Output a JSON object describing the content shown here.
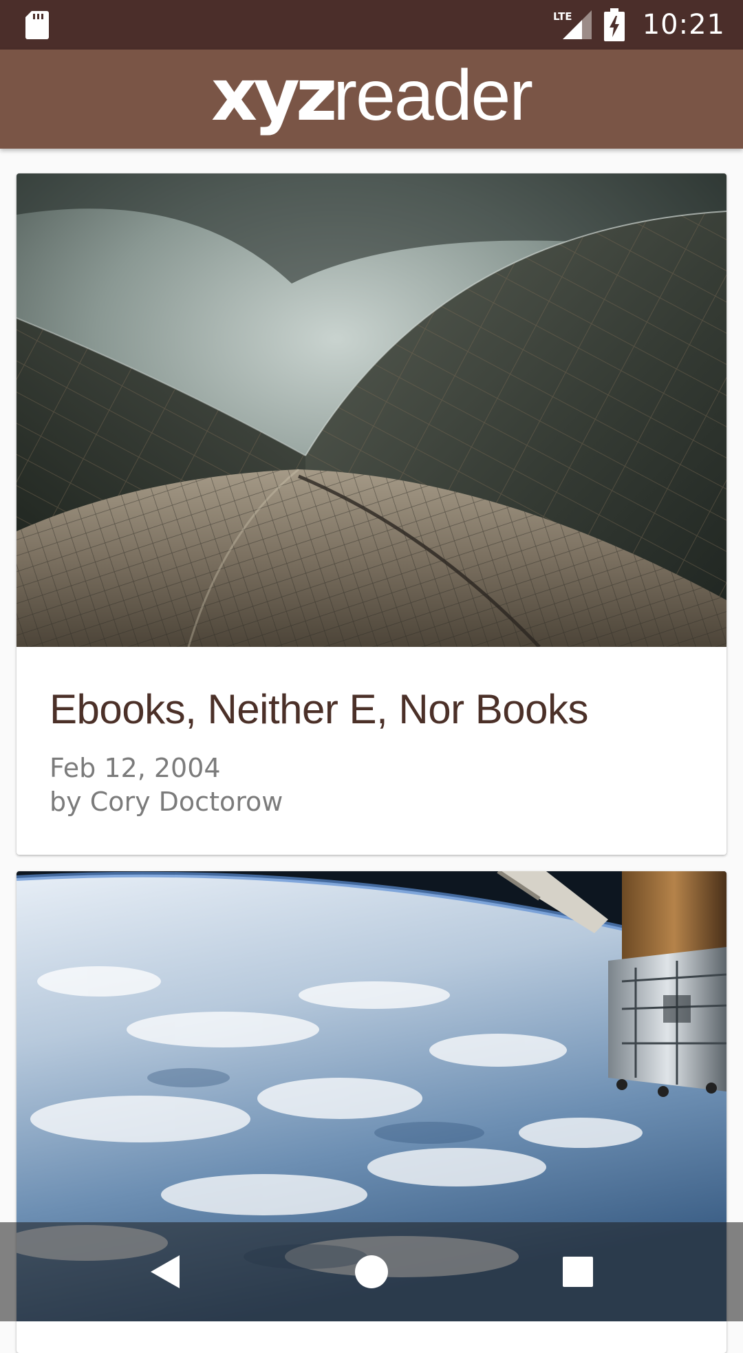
{
  "status_bar": {
    "time": "10:21",
    "network_label": "LTE",
    "icons": [
      "sd-card-icon",
      "lte-signal-icon",
      "battery-charging-icon"
    ]
  },
  "app_bar": {
    "logo_bold": "xyz",
    "logo_light": "reader"
  },
  "articles": [
    {
      "title": "Ebooks, Neither E, Nor Books",
      "date": "Feb 12, 2004",
      "author": "by Cory Doctorow",
      "image": "opera-house-shells-photo"
    },
    {
      "image": "earth-from-space-station-photo"
    }
  ],
  "nav_bar": {
    "icons": [
      "back-icon",
      "home-icon",
      "recents-icon"
    ]
  },
  "colors": {
    "status_bar": "#4b2e2a",
    "app_bar": "#7a5546",
    "title_text": "#4b3028",
    "meta_text": "#7b7b7b",
    "background": "#fafafa"
  }
}
